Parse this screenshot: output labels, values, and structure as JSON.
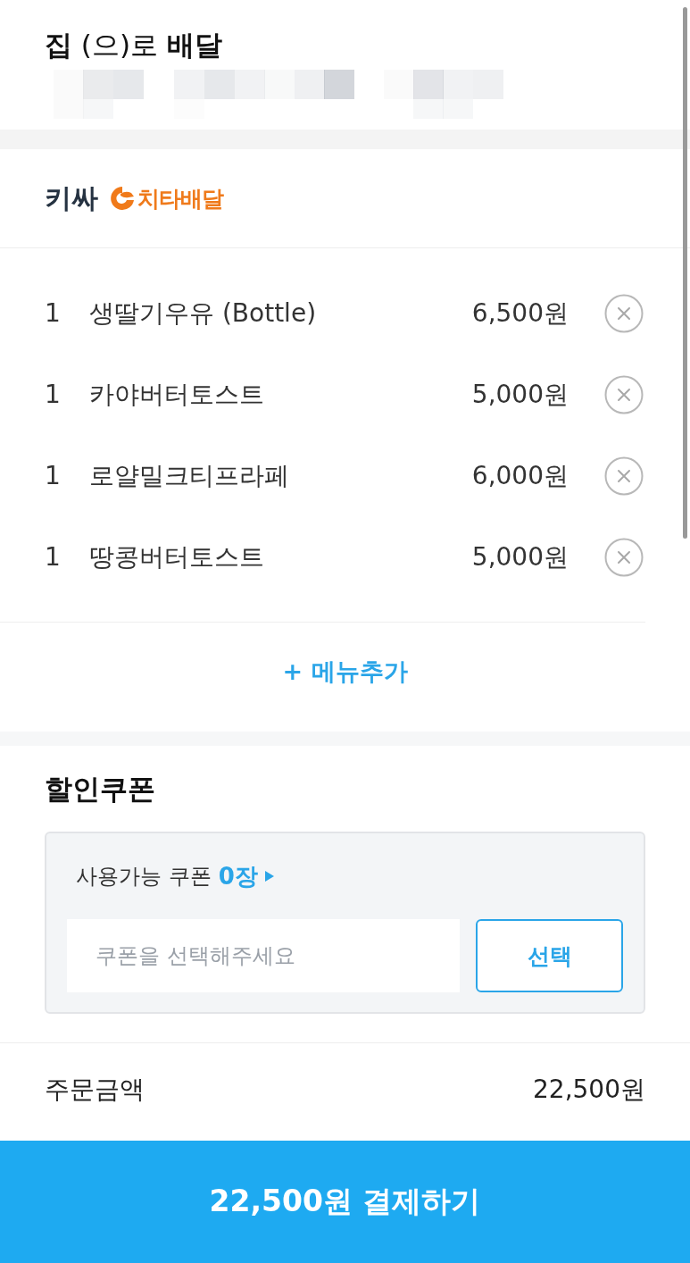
{
  "header": {
    "title": "**집** (으)로 **배달**"
  },
  "store": {
    "name": "키싸",
    "delivery_badge": "치타배달"
  },
  "items": [
    {
      "qty": "1",
      "name": "생딸기우유 (Bottle)",
      "price": "6,500원"
    },
    {
      "qty": "1",
      "name": "카야버터토스트",
      "price": "5,000원"
    },
    {
      "qty": "1",
      "name": "로얄밀크티프라페",
      "price": "6,000원"
    },
    {
      "qty": "1",
      "name": "땅콩버터토스트",
      "price": "5,000원"
    }
  ],
  "add_menu": "+ 메뉴추가",
  "coupon": {
    "title": "할인쿠폰",
    "available_label": "사용가능 쿠폰",
    "available_count": "0장",
    "placeholder": "쿠폰을 선택해주세요",
    "select_button": "선택"
  },
  "order_amount": {
    "label": "주문금액",
    "value": "22,500원"
  },
  "pay_button": "22,500원 결제하기"
}
